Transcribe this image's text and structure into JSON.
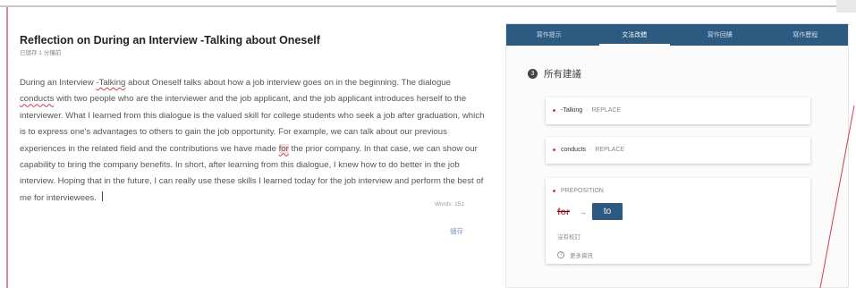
{
  "editor": {
    "title": "Reflection on During an Interview -Talking about Oneself",
    "save_status": "已儲存 1 分鐘前",
    "body": {
      "p1": "During an Interview ",
      "flag1": "-Talking",
      "p2": " about Oneself talks about how a job interview goes on in the beginning. The dialogue ",
      "flag2": "conducts",
      "p3": " with two people who are the interviewer and the job applicant, and the job applicant introduces herself to the interviewer. What I learned from this dialogue is the valued skill for college students who seek a job after graduation, which is to express one's advantages to others to gain the job opportunity. For example, we can talk about our previous experiences in the related field and the contributions we have made ",
      "flag3": "for",
      "p4": " the prior company. In that case, we can show our capability to bring the company benefits. In short, after learning from this dialogue, I knew how to do better in the job interview. Hoping that in the future, I can really use these skills I learned today for the job interview and perform the best of me for interviewees."
    },
    "word_count": "Words: 151",
    "save_label": "儲存"
  },
  "panel": {
    "tabs": [
      {
        "label": "寫作提示",
        "active": false
      },
      {
        "label": "文法改錯",
        "active": true
      },
      {
        "label": "寫作回饋",
        "active": false
      },
      {
        "label": "寫作歷程",
        "active": false
      }
    ],
    "count": "3",
    "heading": "所有建議",
    "suggestions": [
      {
        "word": "-Talking",
        "sep": "·",
        "type": "REPLACE"
      },
      {
        "word": "conducts",
        "sep": "·",
        "type": "REPLACE"
      },
      {
        "type": "PREPOSITION",
        "old": "for",
        "new": "to",
        "ignore": "沒有校訂",
        "more": "更多資訊"
      }
    ]
  },
  "icons": {
    "arrow": "arrow-right-icon",
    "help": "help-circle-icon",
    "dot": "error-dot-icon"
  },
  "colors": {
    "accent": "#2d5a80",
    "error": "#d33a4e"
  }
}
